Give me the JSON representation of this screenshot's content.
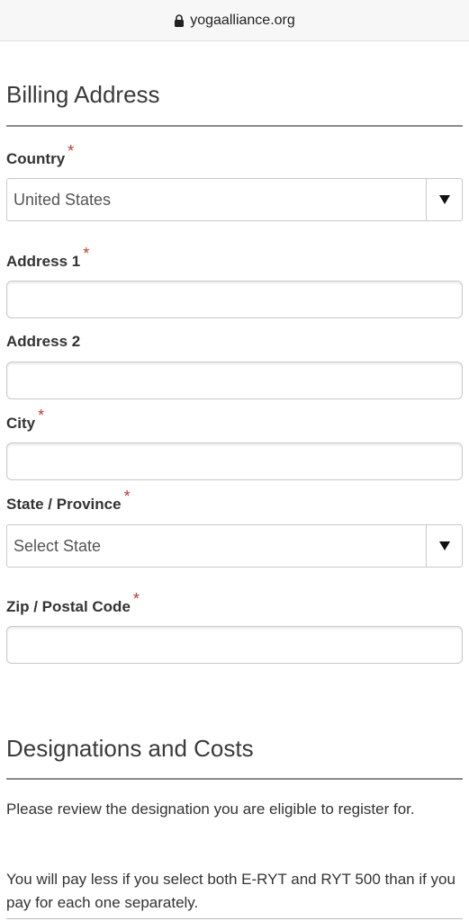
{
  "browser": {
    "url": "yogaalliance.org"
  },
  "billing": {
    "title": "Billing Address",
    "required_mark": "*",
    "country": {
      "label": "Country",
      "value": "United States"
    },
    "address1": {
      "label": "Address 1",
      "value": ""
    },
    "address2": {
      "label": "Address 2",
      "value": ""
    },
    "city": {
      "label": "City",
      "value": ""
    },
    "state": {
      "label": "State / Province",
      "value": "Select State"
    },
    "zip": {
      "label": "Zip / Postal Code",
      "value": ""
    }
  },
  "designations": {
    "title": "Designations and Costs",
    "paragraph1": "Please review the designation you are eligible to register for.",
    "paragraph2": "You will pay less if you select both E-RYT and RYT 500 than if you pay for each one separately."
  },
  "colors": {
    "required": "#b5412f",
    "rule": "#8a8a8a",
    "border": "#c9c9c9"
  },
  "icons": {
    "lock": "lock-icon",
    "dropdown": "triangle-down-icon"
  }
}
